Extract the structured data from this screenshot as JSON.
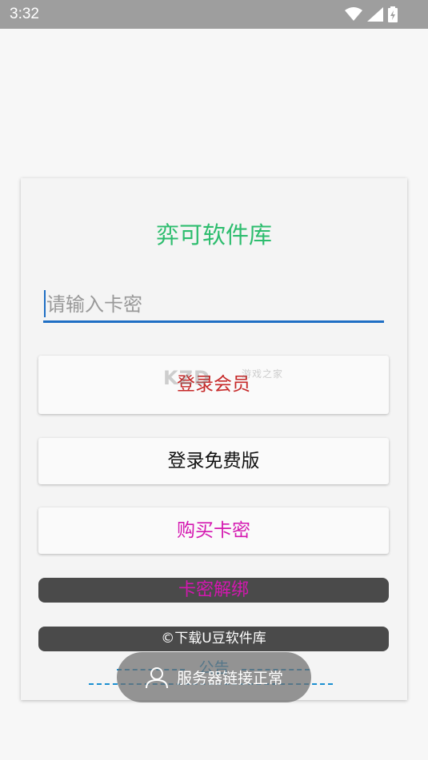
{
  "status_bar": {
    "time": "3:32"
  },
  "card": {
    "title": "弈可软件库",
    "input": {
      "placeholder": "请输入卡密",
      "value": ""
    },
    "buttons": {
      "member_login": "登录会员",
      "free_login": "登录免费版",
      "buy_card": "购买卡密",
      "unbind_card": "卡密解绑"
    },
    "copyright": "©下载U豆软件库",
    "notice_title": "公告",
    "watermark": {
      "main": "KZD",
      "sub": "游戏之家"
    }
  },
  "toast": {
    "message": "服务器链接正常"
  },
  "colors": {
    "title": "#2dbd6e",
    "accent": "#1f6fc4",
    "member": "#c62828",
    "buy": "#d417b0",
    "notice": "#1a8fd1"
  }
}
